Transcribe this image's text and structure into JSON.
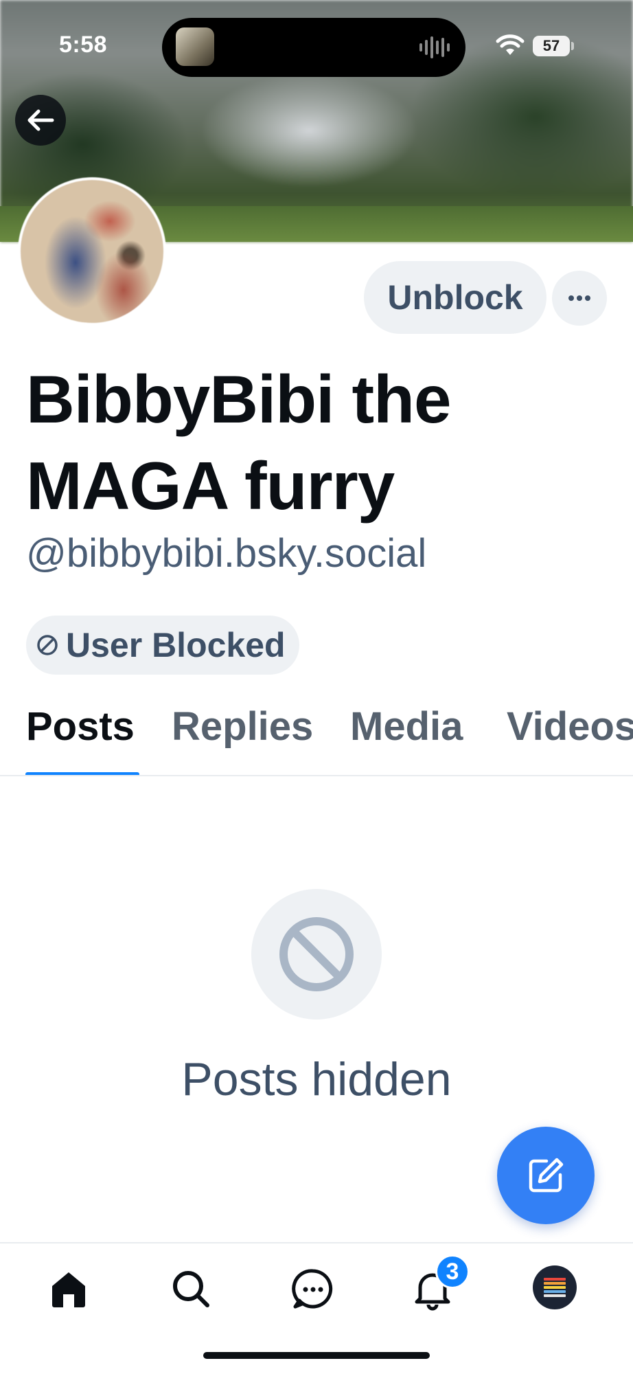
{
  "status_bar": {
    "time": "5:58",
    "battery": "57"
  },
  "profile": {
    "display_name": "BibbyBibi the MAGA furry",
    "handle": "@bibbybibi.bsky.social",
    "unblock_label": "Unblock",
    "blocked_badge": "User Blocked"
  },
  "tabs": [
    {
      "label": "Posts",
      "active": true
    },
    {
      "label": "Replies",
      "active": false
    },
    {
      "label": "Media",
      "active": false
    },
    {
      "label": "Videos",
      "active": false
    }
  ],
  "empty_state": {
    "icon": "block-icon",
    "text": "Posts hidden"
  },
  "bottom_nav": {
    "items": [
      "home-icon",
      "search-icon",
      "chat-icon",
      "bell-icon",
      "profile-avatar"
    ],
    "notification_count": "3"
  },
  "colors": {
    "accent": "#1083fe",
    "fab": "#3380f5",
    "muted_text": "#3d4f66",
    "pill_bg": "#eef1f4"
  }
}
